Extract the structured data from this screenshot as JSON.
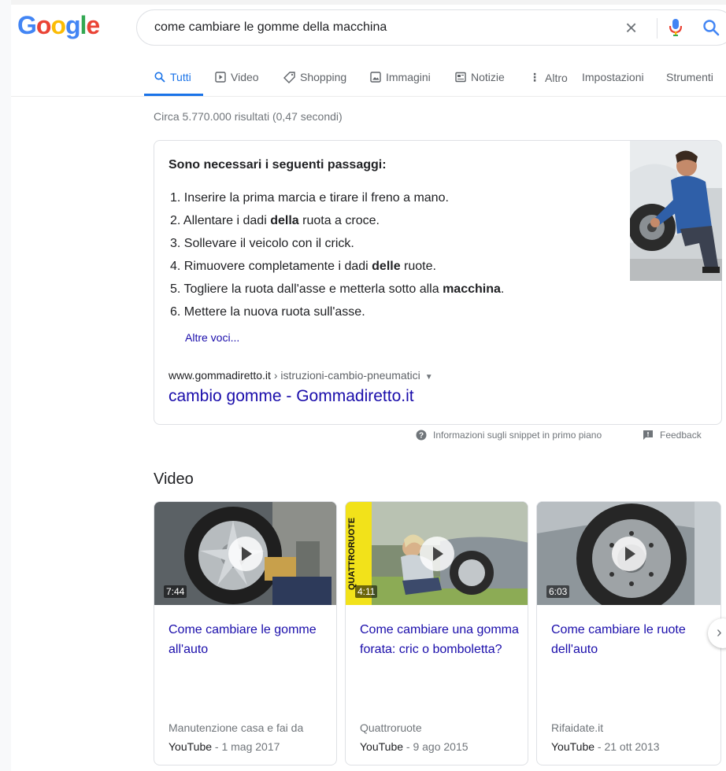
{
  "search": {
    "query": "come cambiare le gomme della macchina"
  },
  "logo": [
    "G",
    "o",
    "o",
    "g",
    "l",
    "e"
  ],
  "logo_colors": [
    "#4285f4",
    "#ea4335",
    "#fbbc05",
    "#4285f4",
    "#34a853",
    "#ea4335"
  ],
  "tabs": [
    {
      "label": "Tutti"
    },
    {
      "label": "Video"
    },
    {
      "label": "Shopping"
    },
    {
      "label": "Immagini"
    },
    {
      "label": "Notizie"
    },
    {
      "label": "Altro"
    },
    {
      "label": "Impostazioni"
    },
    {
      "label": "Strumenti"
    }
  ],
  "results_stats": "Circa 5.770.000 risultati (0,47 secondi)",
  "snippet": {
    "heading": "Sono necessari i seguenti passaggi:",
    "steps": [
      {
        "num": "1.",
        "pre": "Inserire la prima marcia e tirare il freno a mano.",
        "bold": "",
        "post": ""
      },
      {
        "num": "2.",
        "pre": "Allentare i dadi ",
        "bold": "della",
        "post": " ruota a croce."
      },
      {
        "num": "3.",
        "pre": "Sollevare il veicolo con il crick.",
        "bold": "",
        "post": ""
      },
      {
        "num": "4.",
        "pre": "Rimuovere completamente i dadi ",
        "bold": "delle",
        "post": " ruote."
      },
      {
        "num": "5.",
        "pre": "Togliere la ruota dall'asse e metterla sotto alla ",
        "bold": "macchina",
        "post": "."
      },
      {
        "num": "6.",
        "pre": "Mettere la nuova ruota sull'asse.",
        "bold": "",
        "post": ""
      }
    ],
    "more": "Altre voci...",
    "cite_domain": "www.gommadiretto.it",
    "cite_path": " › istruzioni-cambio-pneumatici",
    "title": "cambio gomme - Gommadiretto.it"
  },
  "footer": {
    "info": "Informazioni sugli snippet in primo piano",
    "feedback": "Feedback"
  },
  "video_section": {
    "heading": "Video",
    "videos": [
      {
        "duration": "7:44",
        "title": "Come cambiare le gomme all'auto",
        "channel": "Manutenzione casa e fai da",
        "source": "YouTube",
        "date": " - 1 mag 2017"
      },
      {
        "duration": "4:11",
        "title": "Come cambiare una gomma forata: cric o bomboletta?",
        "channel": "Quattroruote",
        "source": "YouTube",
        "date": " - 9 ago 2015",
        "brand_text": "QUATTRORUOTE"
      },
      {
        "duration": "6:03",
        "title": "Come cambiare le ruote dell'auto",
        "channel": "Rifaidate.it",
        "source": "YouTube",
        "date": " - 21 ott 2013"
      }
    ]
  },
  "colors": {
    "link": "#1a0dab",
    "accent": "#1a73e8",
    "muted": "#70757a"
  }
}
